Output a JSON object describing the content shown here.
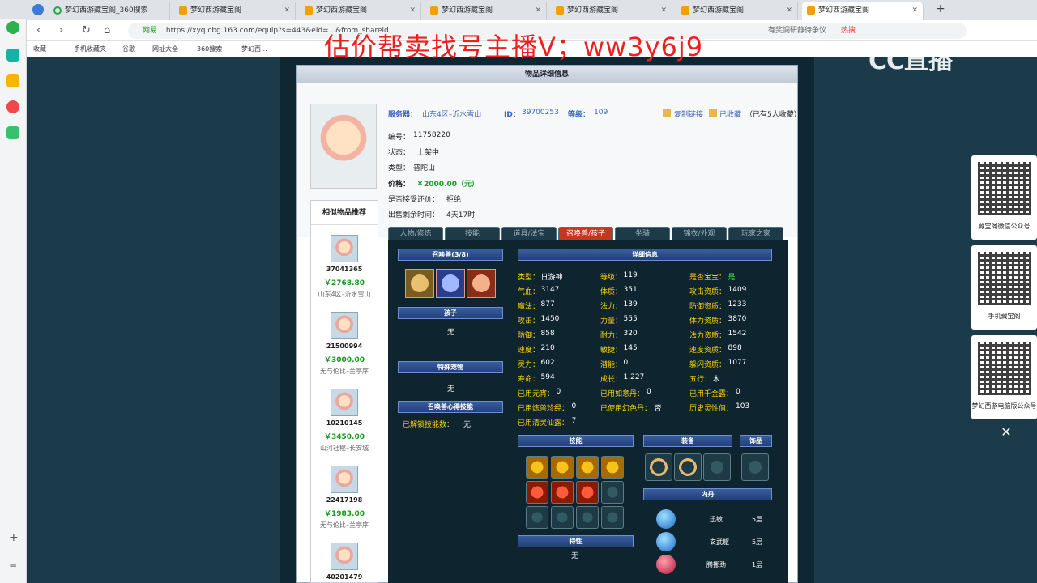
{
  "browser": {
    "tabs": [
      {
        "label": "梦幻西游藏宝阁_360搜索"
      },
      {
        "label": "梦幻西游藏宝阁"
      },
      {
        "label": "梦幻西游藏宝阁"
      },
      {
        "label": "梦幻西游藏宝阁"
      },
      {
        "label": "梦幻西游藏宝阁"
      },
      {
        "label": "梦幻西游藏宝阁"
      },
      {
        "label": "梦幻西游藏宝阁"
      }
    ],
    "url_prefix": "网易",
    "url": "https://xyq.cbg.163.com/equip?s=443&eid=...&from_shareid",
    "hint": "有奖调研静待争议",
    "hot": "热搜",
    "bookmarks": [
      "收藏",
      "手机收藏夹",
      "谷歌",
      "网址大全",
      "360搜索",
      "梦幻西..."
    ]
  },
  "overlay_text": "估价帮卖找号主播V；ww3y6j9",
  "cc_logo": "CC直播",
  "panel_title": "物品详细信息",
  "info": {
    "server_label": "服务器：",
    "server": "山东4区–沂水雪山",
    "id_label": "ID：",
    "id": "39700253",
    "level_label": "等级：",
    "level": "109",
    "copy_link": "复制链接",
    "collected": "已收藏",
    "collect_count": "（已有5人收藏）",
    "number_label": "编号：",
    "number": "11758220",
    "status_label": "状态：",
    "status": "上架中",
    "type_label": "类型：",
    "type": "普陀山",
    "price_label": "价格：",
    "price": "￥2000.00（元）",
    "counter_label": "是否接受还价：",
    "counter": "拒绝",
    "remain_label": "出售剩余时间：",
    "remain": "4天17时"
  },
  "similar": {
    "title": "相似物品推荐",
    "items": [
      {
        "id": "37041365",
        "price": "￥2768.80",
        "server": "山东4区–沂水雪山"
      },
      {
        "id": "21500994",
        "price": "￥3000.00",
        "server": "无与伦比–兰亭序"
      },
      {
        "id": "10210145",
        "price": "￥3450.00",
        "server": "山河社稷–长安城"
      },
      {
        "id": "22417198",
        "price": "￥1983.00",
        "server": "无与伦比–兰亭序"
      },
      {
        "id": "40201479",
        "price": "",
        "server": ""
      }
    ]
  },
  "game_tabs": [
    "人物/修炼",
    "技能",
    "道具/法宝",
    "召唤兽/孩子",
    "坐骑",
    "锦衣/外观",
    "玩家之家"
  ],
  "left_col": {
    "pets_header": "召唤兽(3/8)",
    "child_header": "孩子",
    "child_value": "无",
    "special_header": "特殊宠物",
    "special_value": "无",
    "pet_skill_header": "召唤兽心得技能",
    "unlocked_label": "已解锁技能数：",
    "unlocked_value": "无"
  },
  "detail": {
    "header": "详细信息",
    "rows": [
      [
        [
          "类型：",
          "日游神"
        ],
        [
          "等级：",
          "119"
        ],
        [
          "是否宝宝：",
          "是"
        ]
      ],
      [
        [
          "气血：",
          "3147"
        ],
        [
          "体质：",
          "351"
        ],
        [
          "攻击资质：",
          "1409"
        ]
      ],
      [
        [
          "魔法：",
          "877"
        ],
        [
          "法力：",
          "139"
        ],
        [
          "防御资质：",
          "1233"
        ]
      ],
      [
        [
          "攻击：",
          "1450"
        ],
        [
          "力量：",
          "555"
        ],
        [
          "体力资质：",
          "3870"
        ]
      ],
      [
        [
          "防御：",
          "858"
        ],
        [
          "耐力：",
          "320"
        ],
        [
          "法力资质：",
          "1542"
        ]
      ],
      [
        [
          "速度：",
          "210"
        ],
        [
          "敏捷：",
          "145"
        ],
        [
          "速度资质：",
          "898"
        ]
      ],
      [
        [
          "灵力：",
          "602"
        ],
        [
          "潜能：",
          "0"
        ],
        [
          "躲闪资质：",
          "1077"
        ]
      ],
      [
        [
          "寿命：",
          "594"
        ],
        [
          "成长：",
          "1.227"
        ],
        [
          "五行：",
          "木"
        ]
      ],
      [
        [
          "已用元宵：",
          "0"
        ],
        [
          "已用如意丹：",
          "0"
        ],
        [
          "已用千金露：",
          "0"
        ]
      ],
      [
        [
          "已用炼兽珍经：",
          "0"
        ],
        [
          "已使用幻色丹：",
          "否"
        ],
        [
          "历史灵性值：",
          "103"
        ]
      ],
      [
        [
          "已用清灵仙露：",
          "7"
        ],
        [
          "",
          ""
        ],
        [
          "",
          ""
        ]
      ]
    ]
  },
  "skills_header": "技能",
  "equip_header": "装备",
  "ornament_header": "饰品",
  "trait_header": "特性",
  "trait_value": "无",
  "neidan": {
    "header": "内丹",
    "items": [
      {
        "name": "迅敏",
        "level": "5层"
      },
      {
        "name": "玄武躯",
        "level": "5层"
      },
      {
        "name": "腾挪劲",
        "level": "1层"
      }
    ]
  },
  "qr": [
    {
      "caption": "藏宝阁微信公众号"
    },
    {
      "caption": "手机藏宝阁"
    },
    {
      "caption": "梦幻西游电脑版公众号"
    }
  ],
  "close": "✕"
}
